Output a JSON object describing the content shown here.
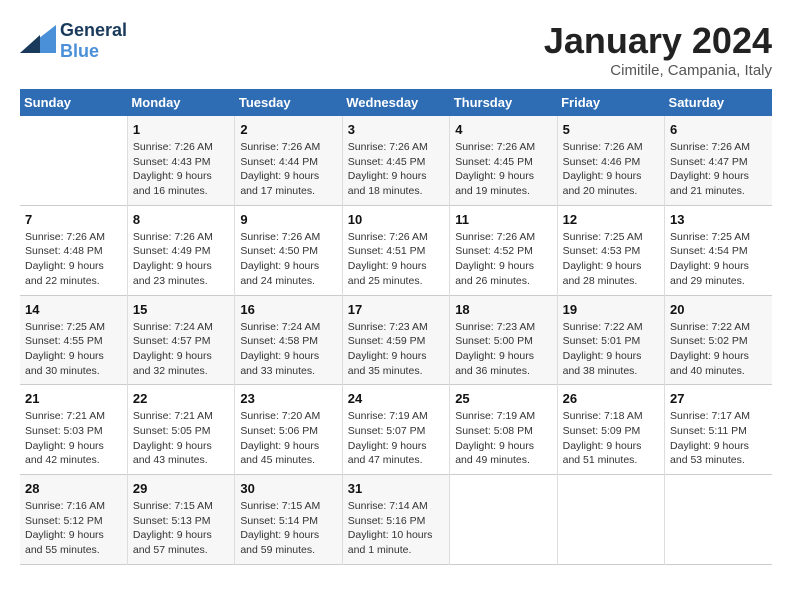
{
  "header": {
    "logo_line1": "General",
    "logo_line2": "Blue",
    "title": "January 2024",
    "subtitle": "Cimitile, Campania, Italy"
  },
  "weekdays": [
    "Sunday",
    "Monday",
    "Tuesday",
    "Wednesday",
    "Thursday",
    "Friday",
    "Saturday"
  ],
  "weeks": [
    [
      {
        "day": null
      },
      {
        "day": "1",
        "sunrise": "7:26 AM",
        "sunset": "4:43 PM",
        "daylight": "9 hours and 16 minutes."
      },
      {
        "day": "2",
        "sunrise": "7:26 AM",
        "sunset": "4:44 PM",
        "daylight": "9 hours and 17 minutes."
      },
      {
        "day": "3",
        "sunrise": "7:26 AM",
        "sunset": "4:45 PM",
        "daylight": "9 hours and 18 minutes."
      },
      {
        "day": "4",
        "sunrise": "7:26 AM",
        "sunset": "4:45 PM",
        "daylight": "9 hours and 19 minutes."
      },
      {
        "day": "5",
        "sunrise": "7:26 AM",
        "sunset": "4:46 PM",
        "daylight": "9 hours and 20 minutes."
      },
      {
        "day": "6",
        "sunrise": "7:26 AM",
        "sunset": "4:47 PM",
        "daylight": "9 hours and 21 minutes."
      }
    ],
    [
      {
        "day": "7",
        "sunrise": "7:26 AM",
        "sunset": "4:48 PM",
        "daylight": "9 hours and 22 minutes."
      },
      {
        "day": "8",
        "sunrise": "7:26 AM",
        "sunset": "4:49 PM",
        "daylight": "9 hours and 23 minutes."
      },
      {
        "day": "9",
        "sunrise": "7:26 AM",
        "sunset": "4:50 PM",
        "daylight": "9 hours and 24 minutes."
      },
      {
        "day": "10",
        "sunrise": "7:26 AM",
        "sunset": "4:51 PM",
        "daylight": "9 hours and 25 minutes."
      },
      {
        "day": "11",
        "sunrise": "7:26 AM",
        "sunset": "4:52 PM",
        "daylight": "9 hours and 26 minutes."
      },
      {
        "day": "12",
        "sunrise": "7:25 AM",
        "sunset": "4:53 PM",
        "daylight": "9 hours and 28 minutes."
      },
      {
        "day": "13",
        "sunrise": "7:25 AM",
        "sunset": "4:54 PM",
        "daylight": "9 hours and 29 minutes."
      }
    ],
    [
      {
        "day": "14",
        "sunrise": "7:25 AM",
        "sunset": "4:55 PM",
        "daylight": "9 hours and 30 minutes."
      },
      {
        "day": "15",
        "sunrise": "7:24 AM",
        "sunset": "4:57 PM",
        "daylight": "9 hours and 32 minutes."
      },
      {
        "day": "16",
        "sunrise": "7:24 AM",
        "sunset": "4:58 PM",
        "daylight": "9 hours and 33 minutes."
      },
      {
        "day": "17",
        "sunrise": "7:23 AM",
        "sunset": "4:59 PM",
        "daylight": "9 hours and 35 minutes."
      },
      {
        "day": "18",
        "sunrise": "7:23 AM",
        "sunset": "5:00 PM",
        "daylight": "9 hours and 36 minutes."
      },
      {
        "day": "19",
        "sunrise": "7:22 AM",
        "sunset": "5:01 PM",
        "daylight": "9 hours and 38 minutes."
      },
      {
        "day": "20",
        "sunrise": "7:22 AM",
        "sunset": "5:02 PM",
        "daylight": "9 hours and 40 minutes."
      }
    ],
    [
      {
        "day": "21",
        "sunrise": "7:21 AM",
        "sunset": "5:03 PM",
        "daylight": "9 hours and 42 minutes."
      },
      {
        "day": "22",
        "sunrise": "7:21 AM",
        "sunset": "5:05 PM",
        "daylight": "9 hours and 43 minutes."
      },
      {
        "day": "23",
        "sunrise": "7:20 AM",
        "sunset": "5:06 PM",
        "daylight": "9 hours and 45 minutes."
      },
      {
        "day": "24",
        "sunrise": "7:19 AM",
        "sunset": "5:07 PM",
        "daylight": "9 hours and 47 minutes."
      },
      {
        "day": "25",
        "sunrise": "7:19 AM",
        "sunset": "5:08 PM",
        "daylight": "9 hours and 49 minutes."
      },
      {
        "day": "26",
        "sunrise": "7:18 AM",
        "sunset": "5:09 PM",
        "daylight": "9 hours and 51 minutes."
      },
      {
        "day": "27",
        "sunrise": "7:17 AM",
        "sunset": "5:11 PM",
        "daylight": "9 hours and 53 minutes."
      }
    ],
    [
      {
        "day": "28",
        "sunrise": "7:16 AM",
        "sunset": "5:12 PM",
        "daylight": "9 hours and 55 minutes."
      },
      {
        "day": "29",
        "sunrise": "7:15 AM",
        "sunset": "5:13 PM",
        "daylight": "9 hours and 57 minutes."
      },
      {
        "day": "30",
        "sunrise": "7:15 AM",
        "sunset": "5:14 PM",
        "daylight": "9 hours and 59 minutes."
      },
      {
        "day": "31",
        "sunrise": "7:14 AM",
        "sunset": "5:16 PM",
        "daylight": "10 hours and 1 minute."
      },
      {
        "day": null
      },
      {
        "day": null
      },
      {
        "day": null
      }
    ]
  ]
}
